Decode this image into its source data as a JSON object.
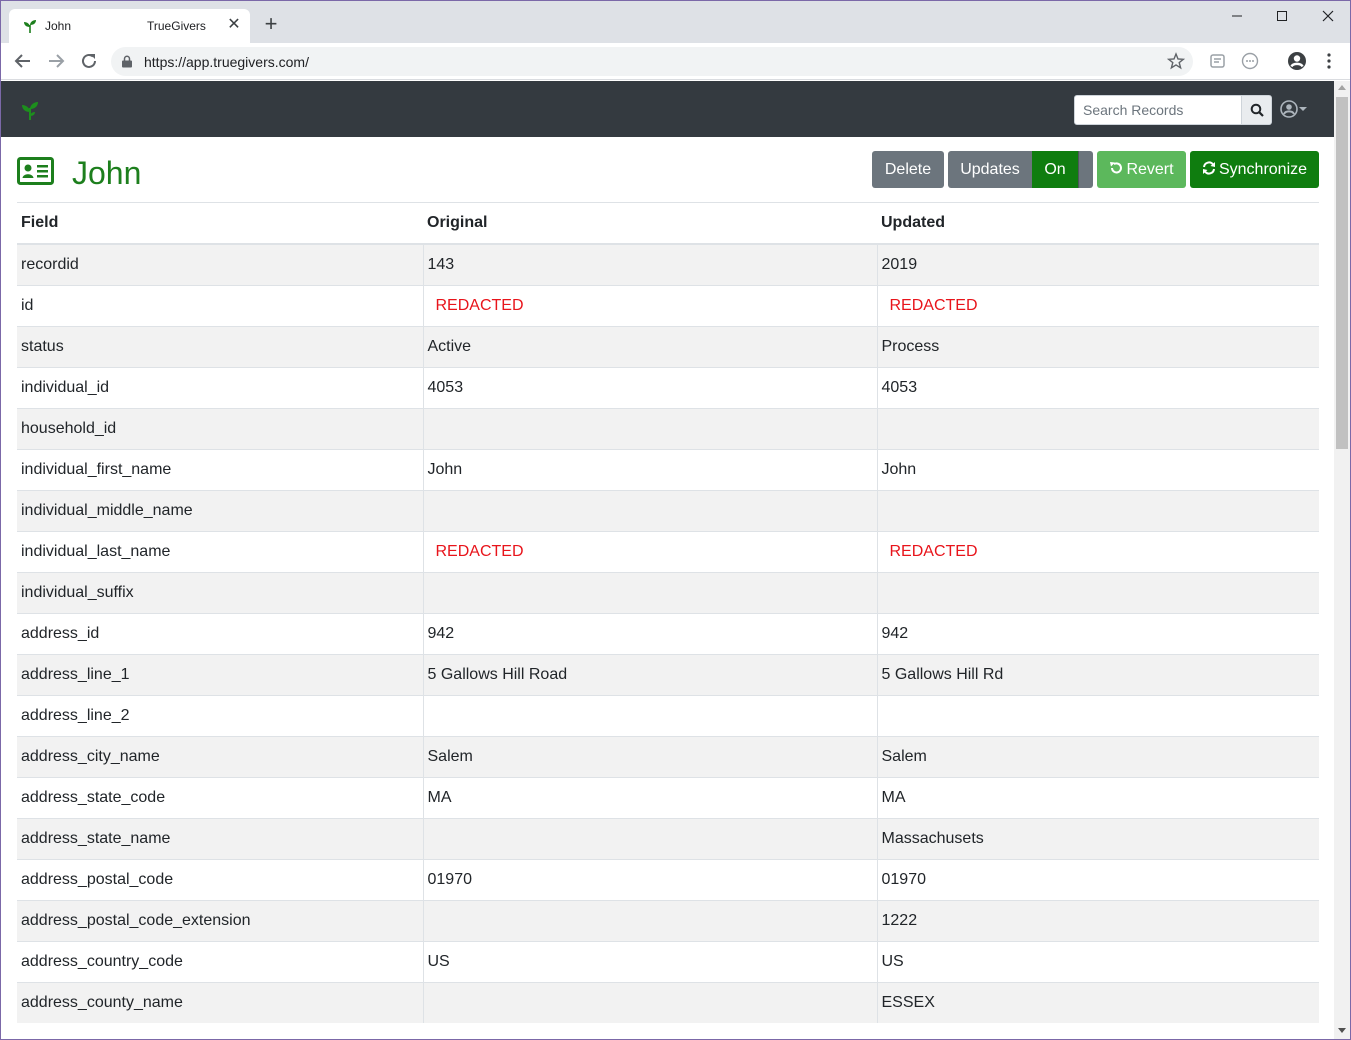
{
  "browser": {
    "tab_title": "John",
    "tab_subtitle": "TrueGivers",
    "url": "https://app.truegivers.com/"
  },
  "app": {
    "search_placeholder": "Search Records"
  },
  "page": {
    "title": "John",
    "buttons": {
      "delete": "Delete",
      "updates": "Updates",
      "on": "On",
      "revert": "Revert",
      "synchronize": "Synchronize"
    }
  },
  "table": {
    "headers": {
      "field": "Field",
      "original": "Original",
      "updated": "Updated"
    },
    "rows": [
      {
        "field": "recordid",
        "original": "143",
        "updated": "2019"
      },
      {
        "field": "id",
        "original": "REDACTED",
        "updated": "REDACTED"
      },
      {
        "field": "status",
        "original": "Active",
        "updated": "Process"
      },
      {
        "field": "individual_id",
        "original": "4053",
        "updated": "4053"
      },
      {
        "field": "household_id",
        "original": "",
        "updated": ""
      },
      {
        "field": "individual_first_name",
        "original": "John",
        "updated": "John"
      },
      {
        "field": "individual_middle_name",
        "original": "",
        "updated": ""
      },
      {
        "field": "individual_last_name",
        "original": "REDACTED",
        "updated": "REDACTED"
      },
      {
        "field": "individual_suffix",
        "original": "",
        "updated": ""
      },
      {
        "field": "address_id",
        "original": "942",
        "updated": "942"
      },
      {
        "field": "address_line_1",
        "original": "5 Gallows Hill Road",
        "updated": "5 Gallows Hill Rd"
      },
      {
        "field": "address_line_2",
        "original": "",
        "updated": ""
      },
      {
        "field": "address_city_name",
        "original": "Salem",
        "updated": "Salem"
      },
      {
        "field": "address_state_code",
        "original": "MA",
        "updated": "MA"
      },
      {
        "field": "address_state_name",
        "original": "",
        "updated": "Massachusets"
      },
      {
        "field": "address_postal_code",
        "original": "01970",
        "updated": "01970"
      },
      {
        "field": "address_postal_code_extension",
        "original": "",
        "updated": "1222"
      },
      {
        "field": "address_country_code",
        "original": "US",
        "updated": "US"
      },
      {
        "field": "address_county_name",
        "original": "",
        "updated": "ESSEX"
      }
    ]
  },
  "colors": {
    "brand_green": "#1d7f1d",
    "navbar": "#343a40",
    "redacted": "#e8141b"
  }
}
